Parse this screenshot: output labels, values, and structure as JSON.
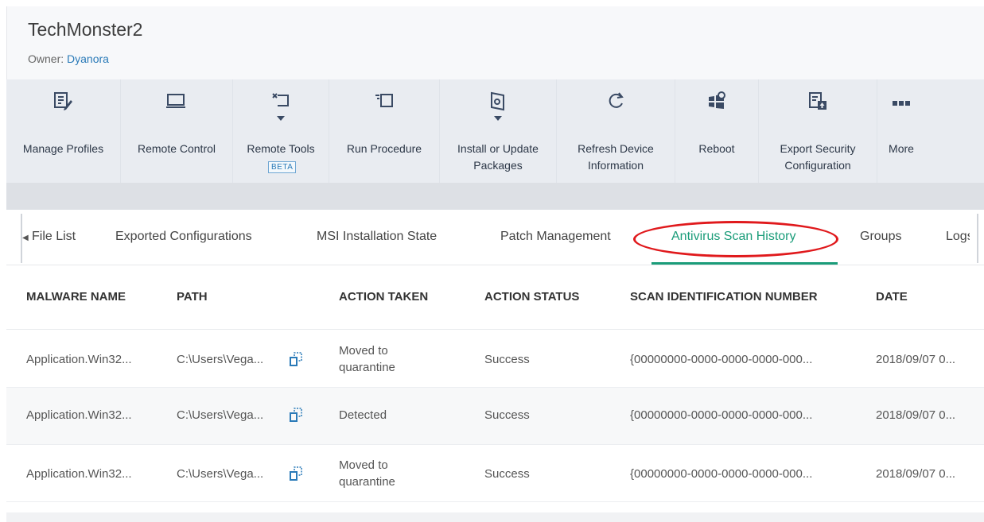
{
  "device": {
    "name": "TechMonster2",
    "owner_label": "Owner:",
    "owner_name": "Dyanora"
  },
  "toolbar": {
    "manage_profiles": "Manage Profiles",
    "remote_control": "Remote Control",
    "remote_tools": "Remote Tools",
    "remote_tools_badge": "BETA",
    "run_procedure": "Run Procedure",
    "install_line1": "Install or Update",
    "install_line2": "Packages",
    "refresh_line1": "Refresh Device",
    "refresh_line2": "Information",
    "reboot": "Reboot",
    "export_line1": "Export Security",
    "export_line2": "Configuration",
    "more": "More"
  },
  "tabs": {
    "file_list": "File List",
    "exported_configurations": "Exported Configurations",
    "msi_installation_state": "MSI Installation State",
    "patch_management": "Patch Management",
    "antivirus_scan_history": "Antivirus Scan History",
    "groups": "Groups",
    "logs": "Logs"
  },
  "table": {
    "headers": {
      "malware_name": "MALWARE NAME",
      "path": "PATH",
      "action_taken": "ACTION TAKEN",
      "action_status": "ACTION STATUS",
      "scan_id": "SCAN IDENTIFICATION NUMBER",
      "date": "DATE"
    },
    "rows": [
      {
        "malware_name": "Application.Win32...",
        "path": "C:\\Users\\Vega...",
        "action_line1": "Moved to",
        "action_line2": "quarantine",
        "status": "Success",
        "scan_id": "{00000000-0000-0000-0000-000...",
        "date": "2018/09/07 0..."
      },
      {
        "malware_name": "Application.Win32...",
        "path": "C:\\Users\\Vega...",
        "action_line1": "Detected",
        "action_line2": "",
        "status": "Success",
        "scan_id": "{00000000-0000-0000-0000-000...",
        "date": "2018/09/07 0..."
      },
      {
        "malware_name": "Application.Win32...",
        "path": "C:\\Users\\Vega...",
        "action_line1": "Moved to",
        "action_line2": "quarantine",
        "status": "Success",
        "scan_id": "{00000000-0000-0000-0000-000...",
        "date": "2018/09/07 0..."
      }
    ]
  },
  "colors": {
    "accent": "#1a9c79",
    "link": "#2a7ab8",
    "highlight": "#e0191c",
    "icon": "#3a4a64"
  }
}
